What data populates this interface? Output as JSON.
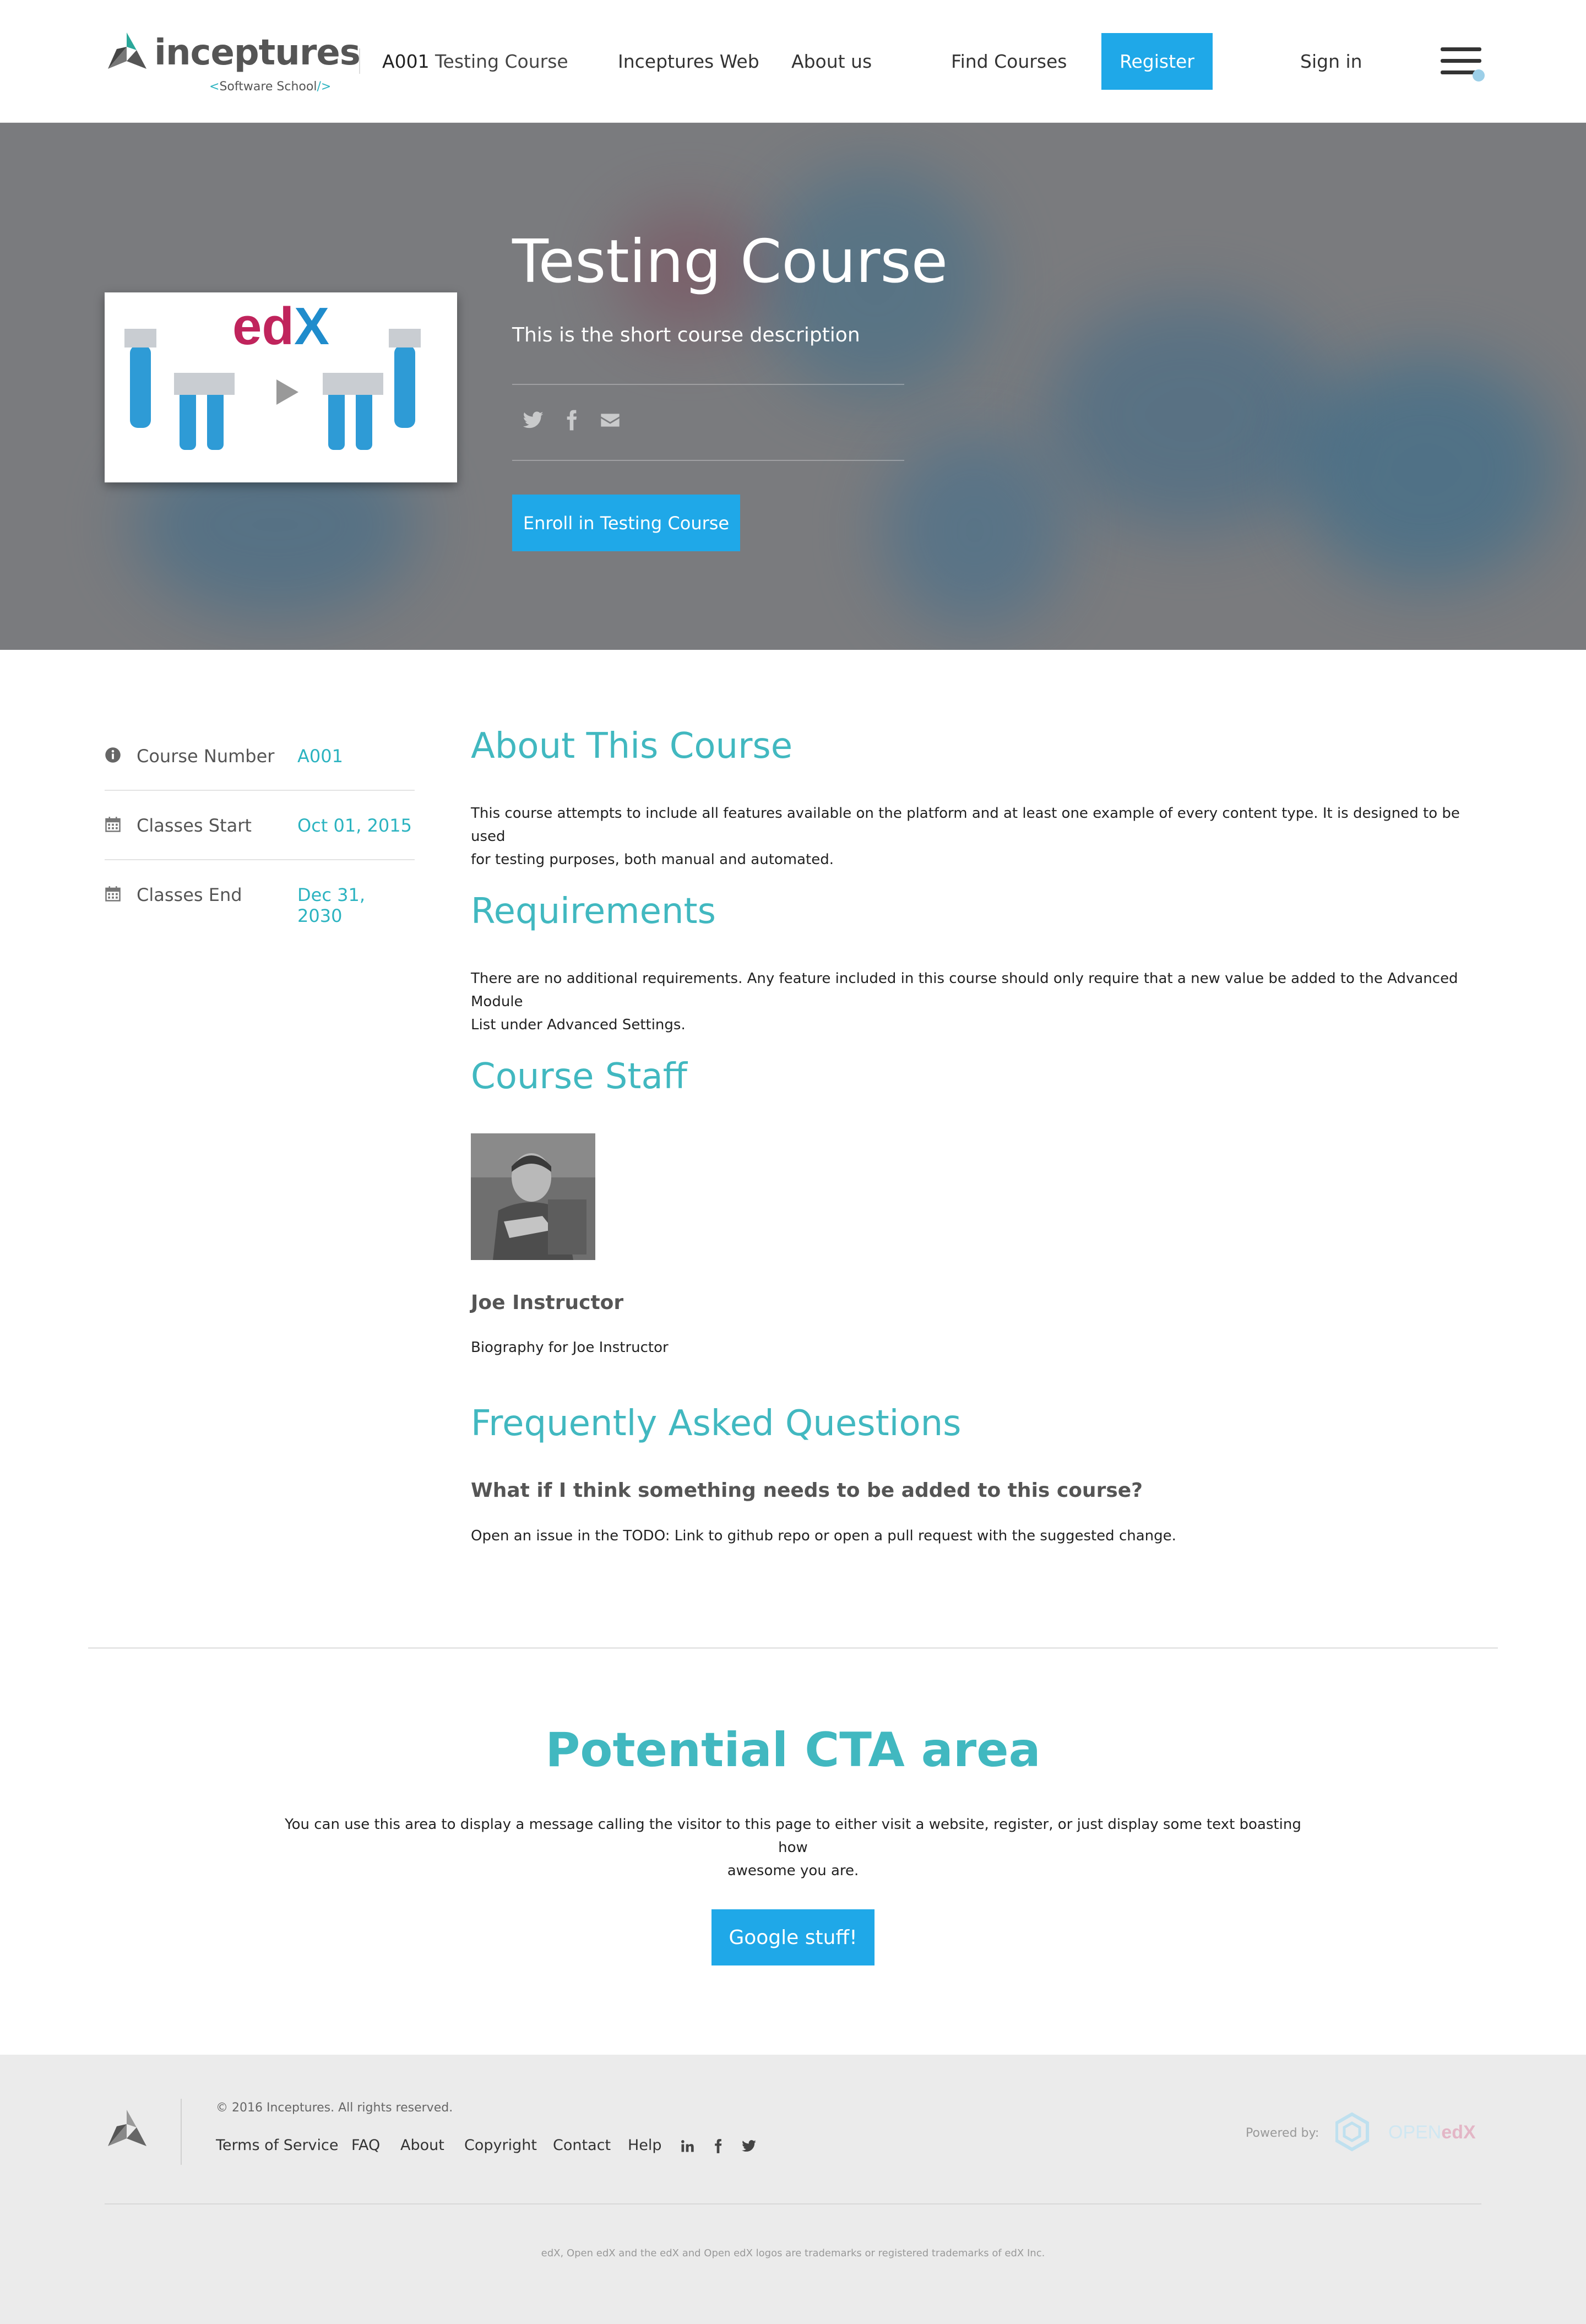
{
  "header": {
    "logo_word": "inceptures",
    "logo_sub_open": "<",
    "logo_sub_text": "Software School",
    "logo_sub_close": "/>",
    "course_id": "A001",
    "course_name": "Testing Course",
    "nav": [
      "Inceptures Web",
      "About us",
      "Find Courses"
    ],
    "register_label": "Register",
    "signin_label": "Sign in"
  },
  "hero": {
    "title": "Testing Course",
    "short_description": "This is the short course description",
    "enroll_label": "Enroll in Testing Course",
    "video_logo": "edX"
  },
  "sidebar": [
    {
      "label": "Course Number",
      "value": "A001",
      "icon": "info-icon"
    },
    {
      "label": "Classes Start",
      "value": "Oct 01, 2015",
      "icon": "calendar-icon"
    },
    {
      "label": "Classes End",
      "value": "Dec 31, 2030",
      "icon": "calendar-icon"
    }
  ],
  "about": {
    "heading": "About This Course",
    "text_line1": "This course attempts to include all features available on the platform and at least one example of every content type. It is designed to be used",
    "text_line2": "for testing purposes, both manual and automated."
  },
  "requirements": {
    "heading": "Requirements",
    "text_line1": "There are no additional requirements. Any feature included in this course should only require that a new value be added to the Advanced Module",
    "text_line2": "List under Advanced Settings."
  },
  "staff": {
    "heading": "Course Staff",
    "name": "Joe Instructor",
    "bio": "Biography for Joe Instructor"
  },
  "faq": {
    "heading": "Frequently Asked Questions",
    "question": "What if I think something needs to be added to this course?",
    "answer": "Open an issue in the TODO: Link to github repo or open a pull request with the suggested change."
  },
  "cta": {
    "title": "Potential CTA area",
    "text_line1": "You can use this area to display a message calling the visitor to this page to either visit a website, register, or just display some text boasting how",
    "text_line2": "awesome you are.",
    "button_label": "Google stuff!"
  },
  "footer": {
    "copyright": "© 2016 Inceptures. All rights reserved.",
    "links": [
      "Terms of Service",
      "FAQ",
      "About",
      "Copyright",
      "Contact",
      "Help"
    ],
    "powered_by": "Powered by:",
    "openedx_text_open": "OPEN",
    "openedx_text_edx": "edX",
    "trademark": "edX, Open edX and the edX and Open edX logos are trademarks or registered trademarks of edX Inc."
  },
  "colors": {
    "accent": "#1fa8e8",
    "heading_teal": "#41b8c0",
    "hero_bg": "#7a7b7e",
    "footer_bg": "#ebebeb"
  }
}
